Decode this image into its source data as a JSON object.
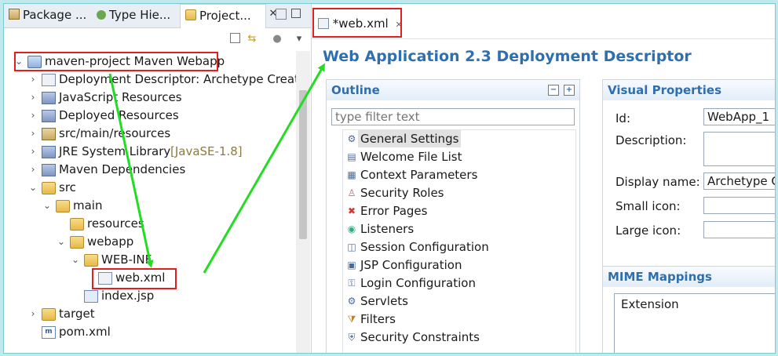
{
  "left": {
    "tabs": [
      {
        "label": "Package ...",
        "icon": "package-icon"
      },
      {
        "label": "Type Hie...",
        "icon": "hierarchy-icon"
      },
      {
        "label": "Project...",
        "icon": "project-explorer-icon",
        "active": true
      }
    ],
    "tree": [
      {
        "label": "maven-project Maven Webapp",
        "icon": "maven-project-icon",
        "twisty": "down"
      },
      {
        "label": "Deployment Descriptor: Archetype Create",
        "icon": "deployment-descriptor-icon",
        "twisty": "right"
      },
      {
        "label": "JavaScript Resources",
        "icon": "javascript-resources-icon",
        "twisty": "right"
      },
      {
        "label": "Deployed Resources",
        "icon": "deployed-resources-icon",
        "twisty": "right"
      },
      {
        "label": "src/main/resources",
        "icon": "source-folder-icon",
        "twisty": "right"
      },
      {
        "label": "JRE System Library",
        "decoration": "[JavaSE-1.8]",
        "icon": "library-icon",
        "twisty": "right"
      },
      {
        "label": "Maven Dependencies",
        "icon": "library-icon",
        "twisty": "right"
      },
      {
        "label": "src",
        "icon": "folder-icon",
        "twisty": "down"
      },
      {
        "label": "main",
        "icon": "folder-icon",
        "twisty": "down"
      },
      {
        "label": "resources",
        "icon": "folder-icon",
        "twisty": ""
      },
      {
        "label": "webapp",
        "icon": "folder-icon",
        "twisty": "down"
      },
      {
        "label": "WEB-INF",
        "icon": "folder-icon",
        "twisty": "down"
      },
      {
        "label": "web.xml",
        "icon": "xml-file-icon",
        "twisty": ""
      },
      {
        "label": "index.jsp",
        "icon": "jsp-file-icon",
        "twisty": ""
      },
      {
        "label": "target",
        "icon": "folder-icon",
        "twisty": "right"
      },
      {
        "label": "pom.xml",
        "icon": "pom-file-icon",
        "twisty": ""
      }
    ]
  },
  "editor": {
    "tab_label": "*web.xml",
    "title": "Web Application 2.3 Deployment Descriptor",
    "outline": {
      "heading": "Outline",
      "filter_placeholder": "type filter text",
      "items": [
        {
          "label": "General Settings",
          "icon": "settings-icon",
          "selected": true
        },
        {
          "label": "Welcome File List",
          "icon": "welcome-list-icon"
        },
        {
          "label": "Context Parameters",
          "icon": "parameters-icon"
        },
        {
          "label": "Security Roles",
          "icon": "security-role-icon"
        },
        {
          "label": "Error Pages",
          "icon": "error-page-icon"
        },
        {
          "label": "Listeners",
          "icon": "listener-icon"
        },
        {
          "label": "Session Configuration",
          "icon": "session-icon"
        },
        {
          "label": "JSP Configuration",
          "icon": "jsp-config-icon"
        },
        {
          "label": "Login Configuration",
          "icon": "login-config-icon"
        },
        {
          "label": "Servlets",
          "icon": "servlet-icon"
        },
        {
          "label": "Filters",
          "icon": "filter-icon"
        },
        {
          "label": "Security Constraints",
          "icon": "security-constraint-icon"
        }
      ]
    },
    "visual": {
      "heading": "Visual Properties",
      "fields": [
        {
          "label": "Id:",
          "value": "WebApp_1"
        },
        {
          "label": "Description:",
          "value": ""
        },
        {
          "label": "Display name:",
          "value": "Archetype C"
        },
        {
          "label": "Small icon:",
          "value": ""
        },
        {
          "label": "Large icon:",
          "value": ""
        }
      ]
    },
    "mime": {
      "heading": "MIME Mappings",
      "column": "Extension"
    }
  },
  "colors": {
    "highlight": "#e02020",
    "arrow": "#22dd22",
    "heading": "#2f6fae"
  }
}
